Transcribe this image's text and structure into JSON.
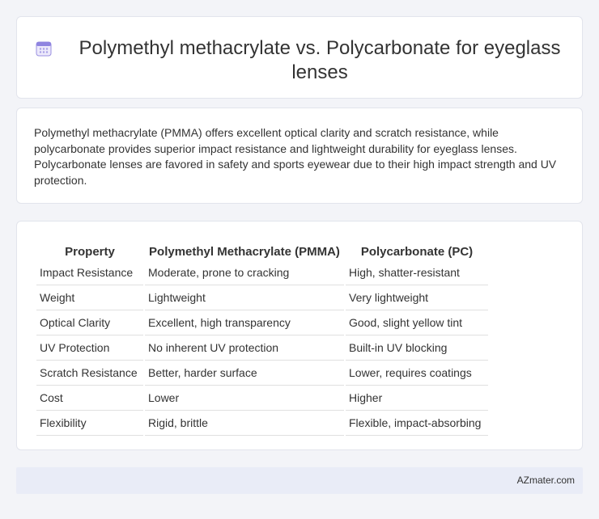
{
  "header": {
    "title": "Polymethyl methacrylate vs. Polycarbonate for eyeglass lenses",
    "icon": "calendar-icon"
  },
  "summary": {
    "text": "Polymethyl methacrylate (PMMA) offers excellent optical clarity and scratch resistance, while polycarbonate provides superior impact resistance and lightweight durability for eyeglass lenses. Polycarbonate lenses are favored in safety and sports eyewear due to their high impact strength and UV protection."
  },
  "table": {
    "headers": [
      "Property",
      "Polymethyl Methacrylate (PMMA)",
      "Polycarbonate (PC)"
    ],
    "rows": [
      [
        "Impact Resistance",
        "Moderate, prone to cracking",
        "High, shatter-resistant"
      ],
      [
        "Weight",
        "Lightweight",
        "Very lightweight"
      ],
      [
        "Optical Clarity",
        "Excellent, high transparency",
        "Good, slight yellow tint"
      ],
      [
        "UV Protection",
        "No inherent UV protection",
        "Built-in UV blocking"
      ],
      [
        "Scratch Resistance",
        "Better, harder surface",
        "Lower, requires coatings"
      ],
      [
        "Cost",
        "Lower",
        "Higher"
      ],
      [
        "Flexibility",
        "Rigid, brittle",
        "Flexible, impact-absorbing"
      ]
    ]
  },
  "footer": {
    "brand": "AZmater.com"
  },
  "colors": {
    "background": "#f3f4f8",
    "card": "#ffffff",
    "footer": "#e9ecf7",
    "icon_accent": "#7b6fd6"
  }
}
